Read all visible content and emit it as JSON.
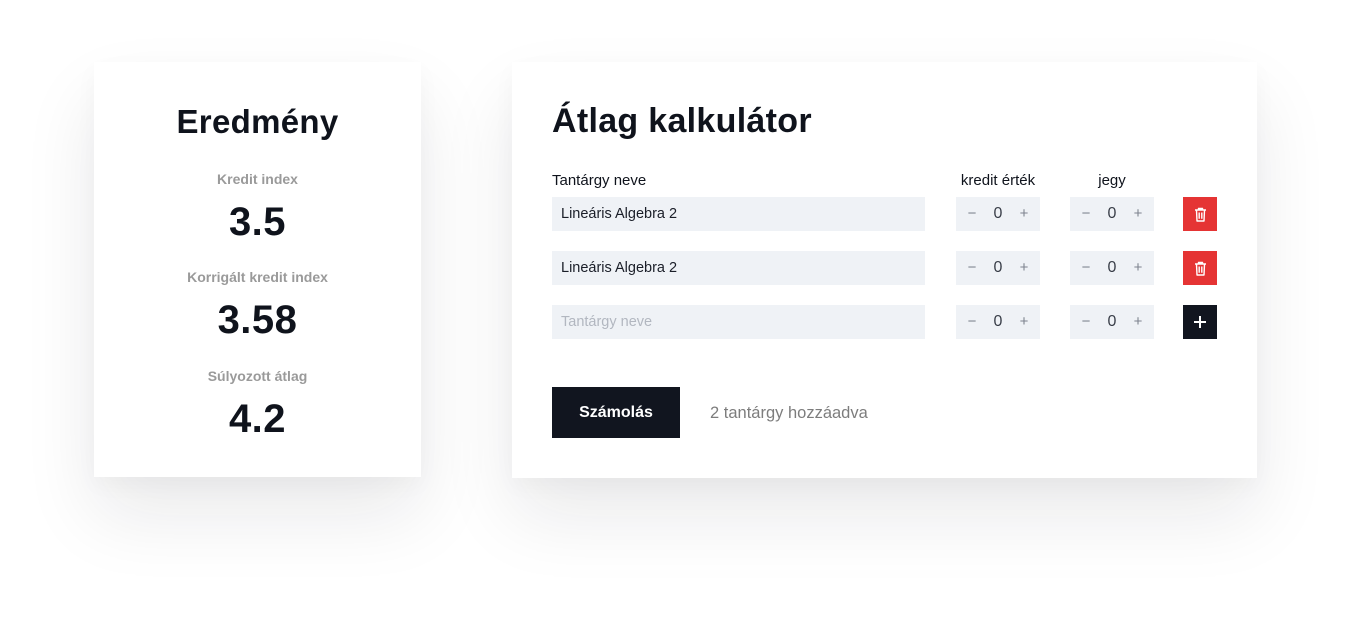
{
  "result": {
    "title": "Eredmény",
    "metrics": [
      {
        "label": "Kredit index",
        "value": "3.5"
      },
      {
        "label": "Korrigált kredit index",
        "value": "3.58"
      },
      {
        "label": "Súlyozott átlag",
        "value": "4.2"
      }
    ]
  },
  "calculator": {
    "title": "Átlag kalkulátor",
    "columns": {
      "name": "Tantárgy neve",
      "credit": "kredit érték",
      "grade": "jegy"
    },
    "rows": [
      {
        "name": "Lineáris Algebra 2",
        "credit": "0",
        "grade": "0",
        "action": "delete"
      },
      {
        "name": "Lineáris Algebra 2",
        "credit": "0",
        "grade": "0",
        "action": "delete"
      },
      {
        "name": "",
        "placeholder": "Tantárgy neve",
        "credit": "0",
        "grade": "0",
        "action": "add"
      }
    ],
    "stepper": {
      "decrement": "−",
      "increment": "+"
    },
    "submit_label": "Számolás",
    "status": "2 tantárgy hozzáadva",
    "icons": {
      "delete": "trash-icon",
      "add": "plus-icon"
    }
  },
  "colors": {
    "accent_dark": "#11151f",
    "delete_red": "#e53434",
    "input_bg": "#eff2f6",
    "muted_text": "#9a9a9a"
  }
}
